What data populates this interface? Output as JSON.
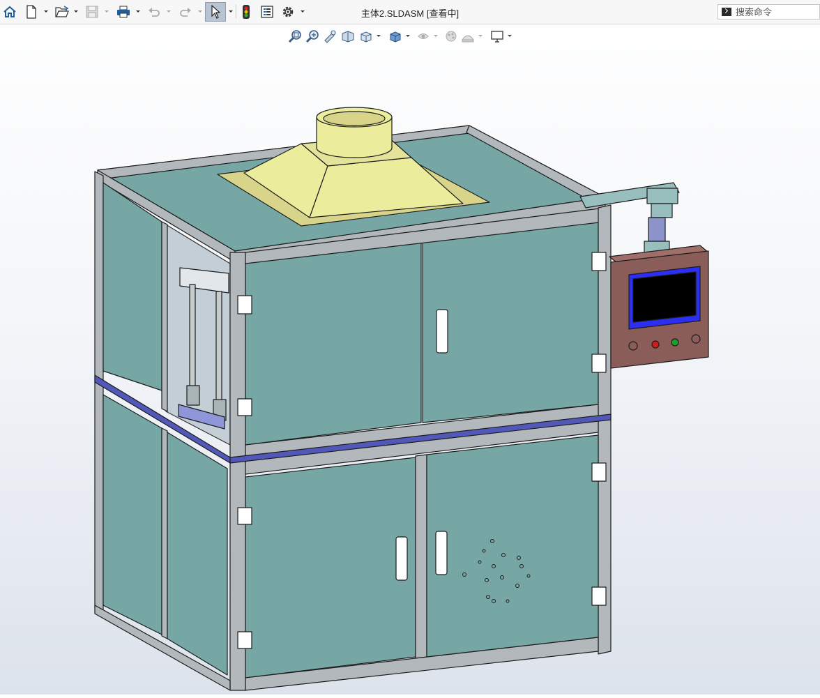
{
  "window": {
    "title": "主体2.SLDASM [查看中]"
  },
  "toolbar": {
    "items": [
      {
        "name": "home-button",
        "icon": "home-icon"
      },
      {
        "name": "new-document-button",
        "icon": "new-document-icon"
      },
      {
        "name": "open-button",
        "icon": "open-folder-icon"
      },
      {
        "name": "save-button",
        "icon": "save-icon"
      },
      {
        "name": "print-button",
        "icon": "print-icon"
      },
      {
        "name": "undo-button",
        "icon": "undo-icon"
      },
      {
        "name": "redo-button",
        "icon": "redo-icon"
      },
      {
        "name": "select-button",
        "icon": "cursor-arrow-icon",
        "active": true
      },
      {
        "name": "rebuild-button",
        "icon": "traffic-light-icon"
      },
      {
        "name": "file-properties-button",
        "icon": "file-properties-icon"
      },
      {
        "name": "options-button",
        "icon": "gear-icon"
      }
    ]
  },
  "search": {
    "placeholder": "搜索命令"
  },
  "heads_up_toolbar": {
    "items": [
      {
        "name": "zoom-to-fit-button",
        "icon": "zoom-to-fit-icon"
      },
      {
        "name": "zoom-to-area-button",
        "icon": "zoom-to-area-icon"
      },
      {
        "name": "previous-view-button",
        "icon": "previous-view-icon"
      },
      {
        "name": "section-view-button",
        "icon": "section-view-icon"
      },
      {
        "name": "view-orientation-button",
        "icon": "view-orientation-icon"
      },
      {
        "name": "display-style-button",
        "icon": "display-style-icon"
      },
      {
        "name": "hide-show-items-button",
        "icon": "hide-show-icon"
      },
      {
        "name": "edit-appearance-button",
        "icon": "appearance-icon"
      },
      {
        "name": "apply-scene-button",
        "icon": "scene-icon"
      },
      {
        "name": "view-settings-button",
        "icon": "monitor-icon"
      }
    ]
  },
  "colors": {
    "panel": "#77a7a5",
    "frame": "#b3b8bd",
    "hood": "#ecec9d",
    "hood_base": "#d8d48a",
    "band": "#5258b8",
    "control_box": "#8a5d59",
    "screen_border": "#2c2ef2",
    "screen": "#000000",
    "arm": "#98bebe",
    "column": "#8d94c9"
  }
}
